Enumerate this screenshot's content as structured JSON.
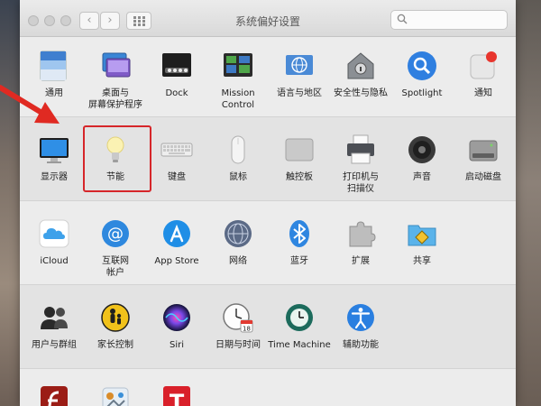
{
  "window": {
    "title": "系统偏好设置",
    "search_placeholder": "",
    "back_glyph": "‹",
    "forward_glyph": "›"
  },
  "rows": [
    {
      "items": [
        {
          "label": "通用",
          "icon": "general-icon"
        },
        {
          "label": "桌面与\n屏幕保护程序",
          "icon": "desktop-screensaver-icon"
        },
        {
          "label": "Dock",
          "icon": "dock-icon"
        },
        {
          "label": "Mission\nControl",
          "icon": "mission-control-icon"
        },
        {
          "label": "语言与地区",
          "icon": "language-region-icon"
        },
        {
          "label": "安全性与隐私",
          "icon": "security-privacy-icon"
        },
        {
          "label": "Spotlight",
          "icon": "spotlight-icon"
        },
        {
          "label": "通知",
          "icon": "notifications-icon"
        }
      ]
    },
    {
      "items": [
        {
          "label": "显示器",
          "icon": "displays-icon"
        },
        {
          "label": "节能",
          "icon": "energy-saver-icon"
        },
        {
          "label": "键盘",
          "icon": "keyboard-icon"
        },
        {
          "label": "鼠标",
          "icon": "mouse-icon"
        },
        {
          "label": "触控板",
          "icon": "trackpad-icon"
        },
        {
          "label": "打印机与\n扫描仪",
          "icon": "printers-scanners-icon"
        },
        {
          "label": "声音",
          "icon": "sound-icon"
        },
        {
          "label": "启动磁盘",
          "icon": "startup-disk-icon"
        }
      ]
    },
    {
      "items": [
        {
          "label": "iCloud",
          "icon": "icloud-icon"
        },
        {
          "label": "互联网\n帐户",
          "icon": "internet-accounts-icon"
        },
        {
          "label": "App Store",
          "icon": "app-store-icon"
        },
        {
          "label": "网络",
          "icon": "network-icon"
        },
        {
          "label": "蓝牙",
          "icon": "bluetooth-icon"
        },
        {
          "label": "扩展",
          "icon": "extensions-icon"
        },
        {
          "label": "共享",
          "icon": "sharing-icon"
        }
      ]
    },
    {
      "items": [
        {
          "label": "用户与群组",
          "icon": "users-groups-icon"
        },
        {
          "label": "家长控制",
          "icon": "parental-controls-icon"
        },
        {
          "label": "Siri",
          "icon": "siri-icon"
        },
        {
          "label": "日期与时间",
          "icon": "date-time-icon"
        },
        {
          "label": "Time Machine",
          "icon": "time-machine-icon"
        },
        {
          "label": "辅助功能",
          "icon": "accessibility-icon"
        }
      ]
    },
    {
      "items": [
        {
          "label": "",
          "icon": "flash-player-icon"
        },
        {
          "label": "",
          "icon": "third-party-pane-icon"
        },
        {
          "label": "",
          "icon": "tuxera-icon"
        }
      ]
    }
  ],
  "date_icon_day": "18",
  "tuxera_glyph": "T",
  "colors": {
    "highlight": "#d6262a",
    "arrow": "#e02a22"
  }
}
